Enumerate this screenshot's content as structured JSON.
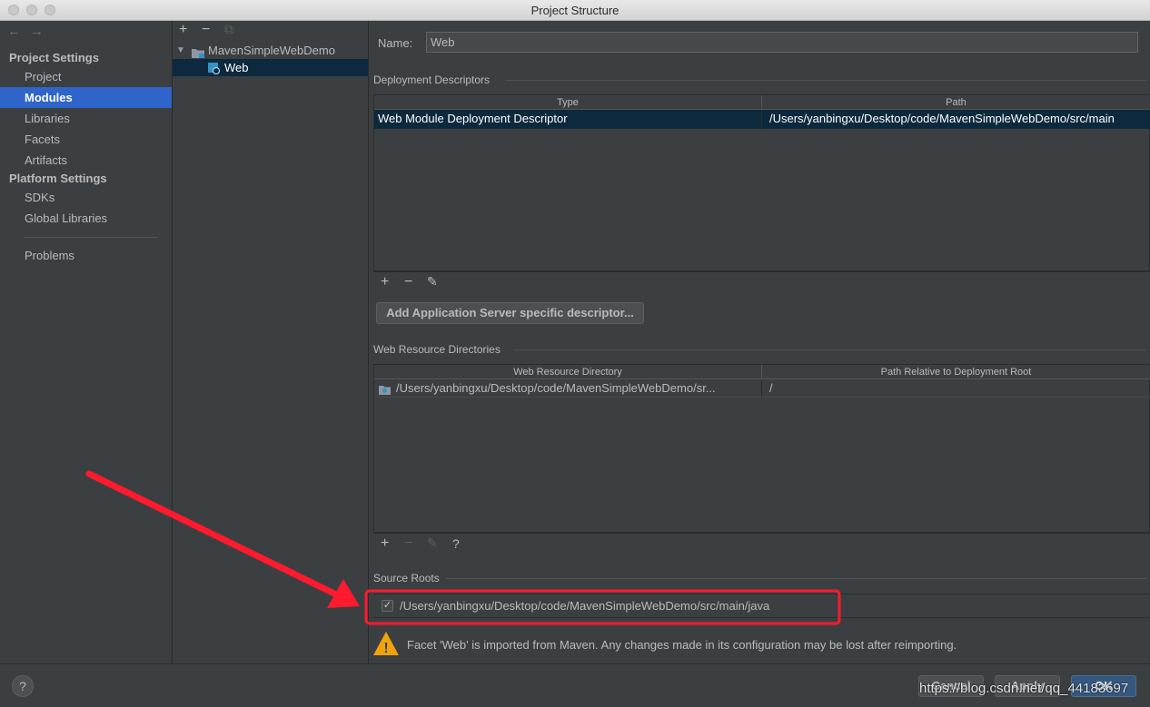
{
  "window": {
    "title": "Project Structure"
  },
  "sidebar": {
    "back_arrow": "←",
    "forward_arrow": "→",
    "project_settings_title": "Project Settings",
    "project_items": [
      {
        "label": "Project"
      },
      {
        "label": "Modules"
      },
      {
        "label": "Libraries"
      },
      {
        "label": "Facets"
      },
      {
        "label": "Artifacts"
      }
    ],
    "selected": "Modules",
    "platform_settings_title": "Platform Settings",
    "platform_items": [
      {
        "label": "SDKs"
      },
      {
        "label": "Global Libraries"
      }
    ],
    "problems_label": "Problems"
  },
  "tree": {
    "add_symbol": "+",
    "remove_symbol": "−",
    "copy_symbol": "⧉",
    "module_name": "MavenSimpleWebDemo",
    "facet_name": "Web"
  },
  "main": {
    "name_label": "Name:",
    "name_value": "Web",
    "deployment": {
      "title": "Deployment Descriptors",
      "columns": [
        "Type",
        "Path"
      ],
      "rows": [
        {
          "type": "Web Module Deployment Descriptor",
          "path": "/Users/yanbingxu/Desktop/code/MavenSimpleWebDemo/src/main"
        }
      ],
      "add_symbol": "+",
      "remove_symbol": "−",
      "edit_symbol": "✎",
      "add_server_button": "Add Application Server specific descriptor..."
    },
    "web_resources": {
      "title": "Web Resource Directories",
      "columns": [
        "Web Resource Directory",
        "Path Relative to Deployment Root"
      ],
      "rows": [
        {
          "directory": "/Users/yanbingxu/Desktop/code/MavenSimpleWebDemo/sr...",
          "relative": "/"
        }
      ],
      "add_symbol": "+",
      "remove_symbol": "−",
      "edit_symbol": "✎",
      "help_symbol": "?"
    },
    "source_roots": {
      "title": "Source Roots",
      "path": "/Users/yanbingxu/Desktop/code/MavenSimpleWebDemo/src/main/java",
      "checked": true,
      "checkmark": "✓"
    },
    "warning": {
      "icon_glyph": "!",
      "text": "Facet 'Web' is imported from Maven. Any changes made in its configuration may be lost after reimporting."
    }
  },
  "footer": {
    "help_symbol": "?",
    "cancel_label": "Cancel",
    "apply_label": "Apply",
    "ok_label": "OK",
    "watermark": "https://blog.csdn.net/qq_44183697"
  },
  "colors": {
    "selection_blue": "#2f65ca",
    "tree_selection": "#0d293e",
    "annotation_red": "#ff1a2e",
    "warning_orange": "#f0a30a"
  }
}
